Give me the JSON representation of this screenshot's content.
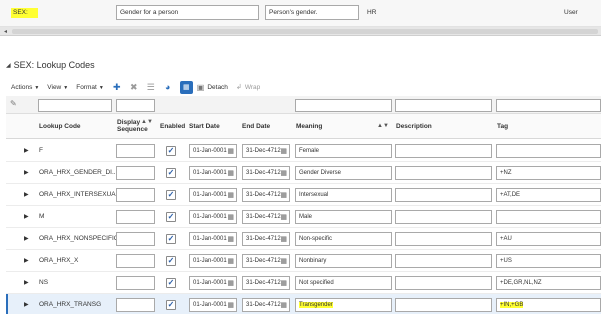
{
  "lookup_type_row": {
    "code": "SEX:",
    "meaning": "Gender for a person",
    "description": "Person's gender.",
    "module": "HR",
    "access": "User"
  },
  "section": {
    "title": "SEX: Lookup Codes"
  },
  "toolbar": {
    "actions": "Actions",
    "view": "View",
    "format": "Format",
    "detach": "Detach",
    "wrap": "Wrap"
  },
  "columns": {
    "lookup_code": "Lookup Code",
    "display_sequence": "Display Sequence",
    "enabled": "Enabled",
    "start_date": "Start Date",
    "end_date": "End Date",
    "meaning": "Meaning",
    "description": "Description",
    "tag": "Tag"
  },
  "rows": [
    {
      "code": "F",
      "seq": "",
      "enabled": true,
      "start": "01-Jan-0001",
      "end": "31-Dec-4712",
      "meaning": "Female",
      "description": "",
      "tag": ""
    },
    {
      "code": "ORA_HRX_GENDER_DI...",
      "seq": "",
      "enabled": true,
      "start": "01-Jan-0001",
      "end": "31-Dec-4712",
      "meaning": "Gender Diverse",
      "description": "",
      "tag": "+NZ"
    },
    {
      "code": "ORA_HRX_INTERSEXUAL",
      "seq": "",
      "enabled": true,
      "start": "01-Jan-0001",
      "end": "31-Dec-4712",
      "meaning": "Intersexual",
      "description": "",
      "tag": "+AT,DE"
    },
    {
      "code": "M",
      "seq": "",
      "enabled": true,
      "start": "01-Jan-0001",
      "end": "31-Dec-4712",
      "meaning": "Male",
      "description": "",
      "tag": ""
    },
    {
      "code": "ORA_HRX_NONSPECIFIC",
      "seq": "",
      "enabled": true,
      "start": "01-Jan-0001",
      "end": "31-Dec-4712",
      "meaning": "Non-specific",
      "description": "",
      "tag": "+AU"
    },
    {
      "code": "ORA_HRX_X",
      "seq": "",
      "enabled": true,
      "start": "01-Jan-0001",
      "end": "31-Dec-4712",
      "meaning": "Nonbinary",
      "description": "",
      "tag": "+US"
    },
    {
      "code": "NS",
      "seq": "",
      "enabled": true,
      "start": "01-Jan-0001",
      "end": "31-Dec-4712",
      "meaning": "Not specified",
      "description": "",
      "tag": "+DE,GR,NL,NZ"
    },
    {
      "code": "ORA_HRX_TRANSG",
      "seq": "",
      "enabled": true,
      "start": "01-Jan-0001",
      "end": "31-Dec-4712",
      "meaning": "Transgender",
      "description": "",
      "tag": "+IN,+GB"
    }
  ],
  "colors": {
    "highlight": "#ffff33",
    "accent": "#2a6ebb",
    "selected_row": "#e7f0fa"
  }
}
